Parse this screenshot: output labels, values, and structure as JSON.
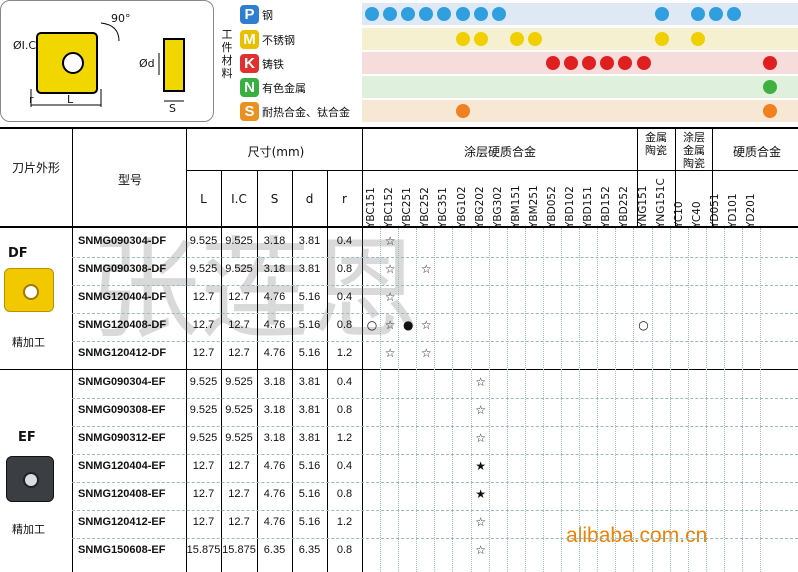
{
  "diagram": {
    "angle_label": "90°",
    "ic_label": "ØI.C",
    "r_label": "r",
    "L_label": "L",
    "d_label": "Ød",
    "S_label": "S"
  },
  "materials": {
    "vertical_label": "工件材料",
    "rows": [
      {
        "code": "P",
        "name": "钢",
        "color": "#2f7fd0",
        "bg": "#dfe9f5"
      },
      {
        "code": "M",
        "name": "不锈钢",
        "color": "#e8c000",
        "bg": "#f5f0d0"
      },
      {
        "code": "K",
        "name": "铸铁",
        "color": "#e03030",
        "bg": "#f7dcdc"
      },
      {
        "code": "N",
        "name": "有色金属",
        "color": "#37b040",
        "bg": "#dff0dc"
      },
      {
        "code": "S",
        "name": "耐热合金、钛合金",
        "color": "#e89020",
        "bg": "#f7e8d6"
      }
    ]
  },
  "table": {
    "header": {
      "shape": "刀片外形",
      "model": "型号",
      "dims": "尺寸(mm)",
      "dim_cols": [
        "L",
        "I.C",
        "S",
        "d",
        "r"
      ],
      "coated": "涂层硬质合金",
      "cermet": "金属陶瓷",
      "coated_cermet": "涂层金属陶瓷",
      "carbide": "硬质合金"
    },
    "grade_cols": [
      "YBC151",
      "YBC152",
      "YBC251",
      "YBC252",
      "YBC351",
      "YBG102",
      "YBG202",
      "YBG302",
      "YBM151",
      "YBM251",
      "YBD052",
      "YBD102",
      "YBD151",
      "YBD152",
      "YBD252",
      "YNG151",
      "YNG151C",
      "YC10",
      "YC40",
      "YD051",
      "YD101",
      "YD201"
    ],
    "groups": [
      {
        "code": "DF",
        "desc": "精加工"
      },
      {
        "code": "EF",
        "desc": "精加工"
      }
    ],
    "rows": [
      {
        "model": "SNMG090304-DF",
        "L": "9.525",
        "IC": "9.525",
        "S": "3.18",
        "d": "3.81",
        "r": "0.4",
        "marks": {
          "YBC152": "☆"
        }
      },
      {
        "model": "SNMG090308-DF",
        "L": "9.525",
        "IC": "9.525",
        "S": "3.18",
        "d": "3.81",
        "r": "0.8",
        "marks": {
          "YBC152": "☆",
          "YBC252": "☆"
        }
      },
      {
        "model": "SNMG120404-DF",
        "L": "12.7",
        "IC": "12.7",
        "S": "4.76",
        "d": "5.16",
        "r": "0.4",
        "marks": {
          "YBC152": "☆"
        }
      },
      {
        "model": "SNMG120408-DF",
        "L": "12.7",
        "IC": "12.7",
        "S": "4.76",
        "d": "5.16",
        "r": "0.8",
        "marks": {
          "YBC151": "○",
          "YBC152": "☆",
          "YBC251": "●",
          "YBC252": "☆",
          "YNG151": "○"
        }
      },
      {
        "model": "SNMG120412-DF",
        "L": "12.7",
        "IC": "12.7",
        "S": "4.76",
        "d": "5.16",
        "r": "1.2",
        "marks": {
          "YBC152": "☆",
          "YBC252": "☆"
        }
      },
      {
        "model": "SNMG090304-EF",
        "L": "9.525",
        "IC": "9.525",
        "S": "3.18",
        "d": "3.81",
        "r": "0.4",
        "marks": {
          "YBG202": "☆"
        }
      },
      {
        "model": "SNMG090308-EF",
        "L": "9.525",
        "IC": "9.525",
        "S": "3.18",
        "d": "3.81",
        "r": "0.8",
        "marks": {
          "YBG202": "☆"
        }
      },
      {
        "model": "SNMG090312-EF",
        "L": "9.525",
        "IC": "9.525",
        "S": "3.18",
        "d": "3.81",
        "r": "1.2",
        "marks": {
          "YBG202": "☆"
        }
      },
      {
        "model": "SNMG120404-EF",
        "L": "12.7",
        "IC": "12.7",
        "S": "4.76",
        "d": "5.16",
        "r": "0.4",
        "marks": {
          "YBG202": "★"
        }
      },
      {
        "model": "SNMG120408-EF",
        "L": "12.7",
        "IC": "12.7",
        "S": "4.76",
        "d": "5.16",
        "r": "0.8",
        "marks": {
          "YBG202": "★"
        }
      },
      {
        "model": "SNMG120412-EF",
        "L": "12.7",
        "IC": "12.7",
        "S": "4.76",
        "d": "5.16",
        "r": "1.2",
        "marks": {
          "YBG202": "☆"
        }
      },
      {
        "model": "SNMG150608-EF",
        "L": "15.875",
        "IC": "15.875",
        "S": "6.35",
        "d": "6.35",
        "r": "0.8",
        "marks": {
          "YBG202": "☆"
        }
      }
    ]
  },
  "watermark": {
    "text": "张莲恩",
    "site": "alibaba.com.cn"
  },
  "colors": {
    "smiley_blue": "#2f9fe0",
    "smiley_yellow": "#f0d000",
    "smiley_red": "#e02020",
    "smiley_green": "#40b040",
    "smiley_orange": "#f08020"
  }
}
